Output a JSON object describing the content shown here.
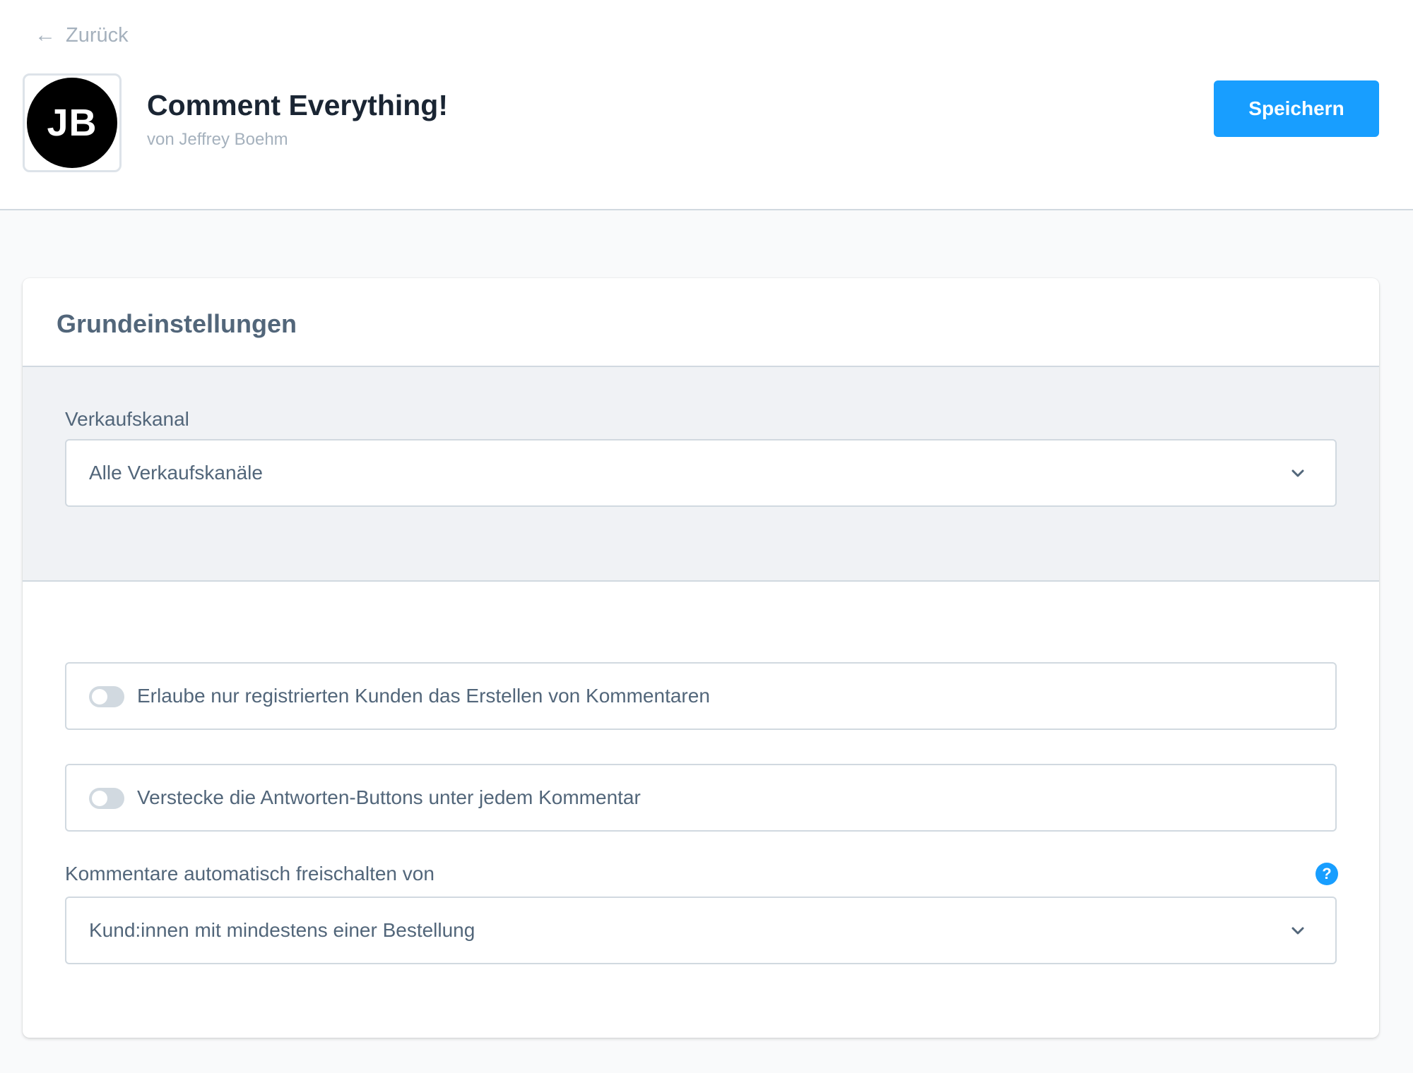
{
  "header": {
    "back_label": "Zurück",
    "back_icon": "arrow-left-icon",
    "logo_initials": "JB",
    "app_title": "Comment Everything!",
    "app_author": "von Jeffrey Boehm",
    "save_label": "Speichern"
  },
  "card": {
    "title": "Grundeinstellungen",
    "sales_channel": {
      "label": "Verkaufskanal",
      "value": "Alle Verkaufskanäle"
    },
    "toggles": [
      {
        "label": "Erlaube nur registrierten Kunden das Erstellen von Kommentaren",
        "checked": false
      },
      {
        "label": "Verstecke die Antworten-Buttons unter jedem Kommentar",
        "checked": false
      }
    ],
    "auto_approve": {
      "label": "Kommentare automatisch freischalten von",
      "value": "Kund:innen mit mindestens einer Bestellung",
      "help_glyph": "?"
    }
  },
  "colors": {
    "accent": "#189eff",
    "text": "#52667a",
    "title": "#1a2533",
    "muted": "#a5b1bd",
    "border": "#d1d9e0"
  }
}
